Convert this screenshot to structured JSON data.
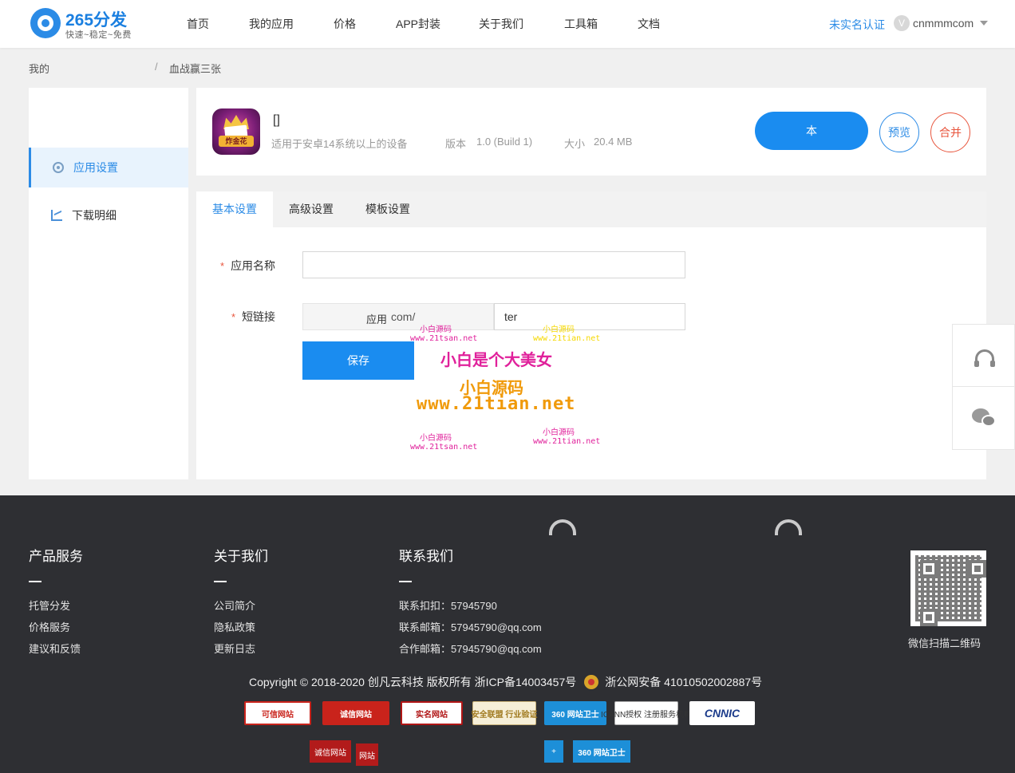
{
  "header": {
    "logo_title": "265分发",
    "logo_subtitle": "快速~稳定~免费",
    "nav": [
      "首页",
      "我的应用",
      "价格",
      "APP封装",
      "关于我们",
      "工具箱",
      "文档"
    ],
    "verify_link": "未实名认证",
    "user_badge": "V",
    "username": "cnmmmcom"
  },
  "breadcrumb": {
    "root": "我的",
    "separator": "/",
    "current": "血战赢三张"
  },
  "sidebar": {
    "items": [
      {
        "label": "应用设置",
        "icon": "gear-icon",
        "active": true
      },
      {
        "label": "下载明细",
        "icon": "chart-icon",
        "active": false
      }
    ]
  },
  "app": {
    "name": "[]",
    "icon_label": "炸金花",
    "description": "适用于安卓14系统以上的设备",
    "version_label": "版本",
    "version_value": "1.0 (Build 1)",
    "size_label": "大小",
    "size_value": "20.4 MB",
    "update_button": "本",
    "preview_button": "预览",
    "merge_button": "合并"
  },
  "tabs": [
    "基本设置",
    "高级设置",
    "模板设置"
  ],
  "form": {
    "name_label": "应用名称",
    "name_value": "",
    "link_label": "短链接",
    "link_prefix": "com/",
    "link_value": "ter",
    "save_button": "保存"
  },
  "watermarks": {
    "small_cn": "小白源码",
    "small_url": "www.21tsan.net",
    "yellow_cn": "小白源码",
    "yellow_url": "www.21tian.net",
    "big_pink": "小白是个大美女",
    "big_orange_cn": "小白源码",
    "big_orange_url": "www.21tian.net",
    "bottom_cn": "小白源码",
    "bottom_url": "www.21tsan.net",
    "bottom2_cn": "小白源码",
    "bottom2_url": "www.21tian.net",
    "save_ghost": "应用"
  },
  "float_bar": {
    "items": [
      "headset-icon",
      "wechat-icon"
    ]
  },
  "footer": {
    "col1": {
      "title": "产品服务",
      "links": [
        "托管分发",
        "价格服务",
        "建议和反馈"
      ]
    },
    "col2": {
      "title": "关于我们",
      "links": [
        "公司简介",
        "隐私政策",
        "更新日志"
      ]
    },
    "col3": {
      "title": "联系我们",
      "links": [
        "联系扣扣：57945790",
        "联系邮箱：57945790@qq.com",
        "合作邮箱：57945790@qq.com"
      ]
    },
    "qr_caption": "微信扫描二维码",
    "copyright": "Copyright © 2018-2020 创凡云科技 版权所有 浙ICP备14003457号",
    "police": "浙公网安备 41010502002887号",
    "badges": [
      "可信网站",
      "诚信网站",
      "实名网站",
      "安全联盟 行业验证",
      "360 网站卫士",
      "ICANN授权 注册服务机构",
      "CNNIC"
    ],
    "badges_row2": [
      "诚信网站",
      "网站",
      "",
      "360 网站卫士"
    ]
  },
  "colors": {
    "accent": "#2b8be6",
    "button_blue": "#1a8cf0",
    "merge_red": "#e8563e",
    "footer_bg": "#2e2f33"
  }
}
